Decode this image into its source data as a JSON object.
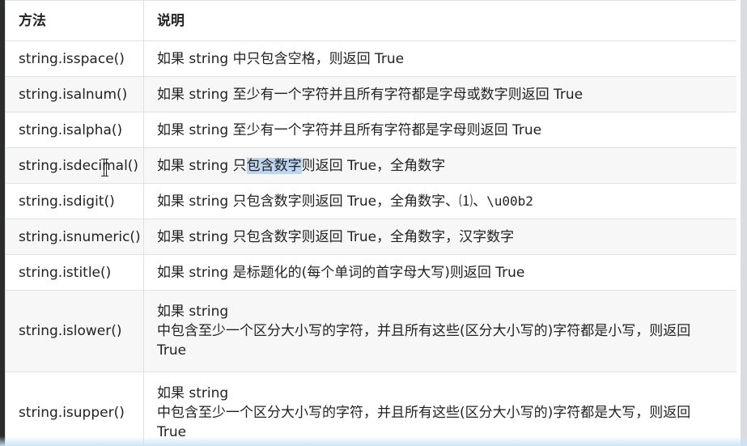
{
  "headers": {
    "method": "方法",
    "description": "说明"
  },
  "rows": [
    {
      "method": "string.isspace()",
      "desc": "如果 string 中只包含空格，则返回 True"
    },
    {
      "method": "string.isalnum()",
      "desc": "如果 string 至少有一个字符并且所有字符都是字母或数字则返回 True"
    },
    {
      "method": "string.isalpha()",
      "desc": "如果 string 至少有一个字符并且所有字符都是字母则返回 True"
    },
    {
      "method": "string.isdecimal()",
      "desc_pre": "如果 string 只",
      "desc_hl": "包含数字",
      "desc_post": "则返回 True，全角数字"
    },
    {
      "method": "string.isdigit()",
      "desc_pre": "如果 string 只包含数字则返回 True，全角数字、⑴、",
      "desc_code": "\\u00b2"
    },
    {
      "method": "string.isnumeric()",
      "desc": "如果 string 只包含数字则返回 True，全角数字，汉字数字"
    },
    {
      "method": "string.istitle()",
      "desc": "如果 string 是标题化的(每个单词的首字母大写)则返回 True"
    },
    {
      "method": "string.islower()",
      "desc_l1": "如果 string",
      "desc_l2": "中包含至少一个区分大小写的字符，并且所有这些(区分大小写的)字符都是小写，则返回",
      "desc_l3": "True"
    },
    {
      "method": "string.isupper()",
      "desc_l1": "如果 string",
      "desc_l2": "中包含至少一个区分大小写的字符，并且所有这些(区分大小写的)字符都是大写，则返回",
      "desc_l3": "True"
    }
  ]
}
